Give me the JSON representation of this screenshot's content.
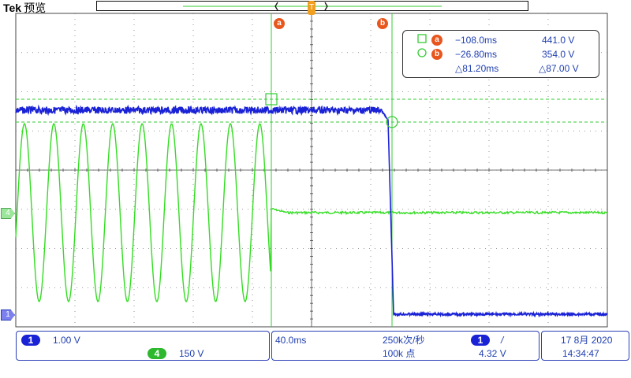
{
  "header": {
    "brand": "Tek",
    "mode": "预览"
  },
  "colors": {
    "ch1": "#1a22d6",
    "ch4": "#33dd22",
    "cursor": "#33cc33",
    "text": "#1f3fb0",
    "accent": "#e8561e",
    "grid": "#555555"
  },
  "cursors": {
    "a_label": "a",
    "b_label": "b"
  },
  "measurements": {
    "a": {
      "time": "−108.0ms",
      "volt": "441.0 V"
    },
    "b": {
      "time": "−26.80ms",
      "volt": "354.0 V"
    },
    "delta": {
      "time": "△81.20ms",
      "volt": "△87.00 V"
    }
  },
  "markers": {
    "ch4": "4",
    "ch1": "1",
    "trigger": "T"
  },
  "status": {
    "ch1_number": "1",
    "ch1_scale": "1.00 V",
    "ch4_number": "4",
    "ch4_scale": "150 V",
    "timebase": "40.0ms",
    "sample_rate": "250k次/秒",
    "record_length": "100k 点",
    "trigger_channel": "1",
    "trigger_slope": "/",
    "trigger_level": "4.32 V",
    "date": "17 8月 2020",
    "time": "14:34:47"
  }
}
